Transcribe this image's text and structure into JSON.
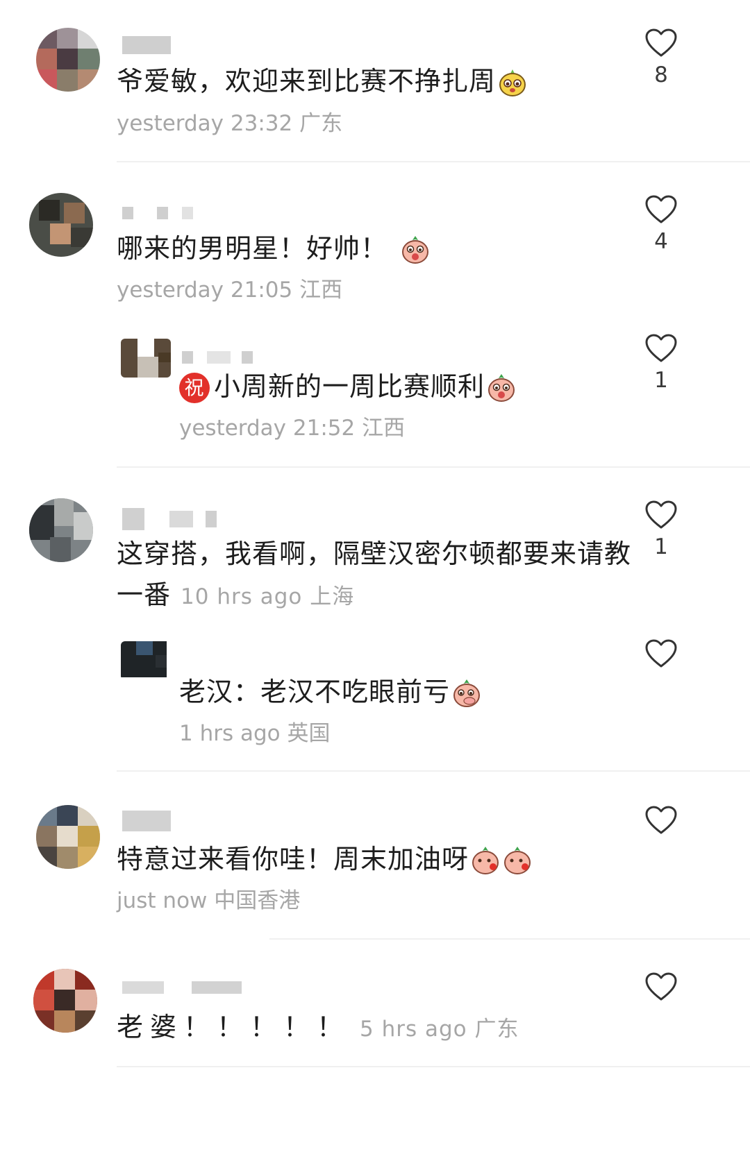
{
  "comments": [
    {
      "text": "爷爱敏，欢迎来到比赛不挣扎周",
      "emoji": "yellow-face-emoji",
      "time": "yesterday 23:32",
      "location": "广东",
      "likes": "8"
    },
    {
      "text": "哪来的男明星！好帅！",
      "emoji": "peach-face-emoji",
      "time": "yesterday 21:05",
      "location": "江西",
      "likes": "4"
    },
    {
      "reply": true,
      "badge": "祝",
      "text": "小周新的一周比赛顺利",
      "emoji": "peach-face-emoji",
      "time": "yesterday 21:52",
      "location": "江西",
      "likes": "1"
    },
    {
      "text_line1": "这穿搭，我看啊，隔壁汉密尔顿都要来请教",
      "text_line2": "一番",
      "time": "10 hrs ago",
      "location": "上海",
      "likes": "1"
    },
    {
      "reply": true,
      "text": "老汉：老汉不吃眼前亏",
      "emoji": "peach-face-emoji",
      "time": "1 hrs ago",
      "location": "英国",
      "likes": ""
    },
    {
      "text": "特意过来看你哇！周末加油呀",
      "emoji": "peach-blush-emoji",
      "time": "just now",
      "location": "中国香港",
      "likes": ""
    },
    {
      "text": "老婆！！！！！",
      "time": "5 hrs ago",
      "location": "广东",
      "likes": ""
    }
  ],
  "colors": {
    "meta": "#a6a6a6",
    "badge": "#e2302a",
    "divider": "#f0f0f0"
  }
}
